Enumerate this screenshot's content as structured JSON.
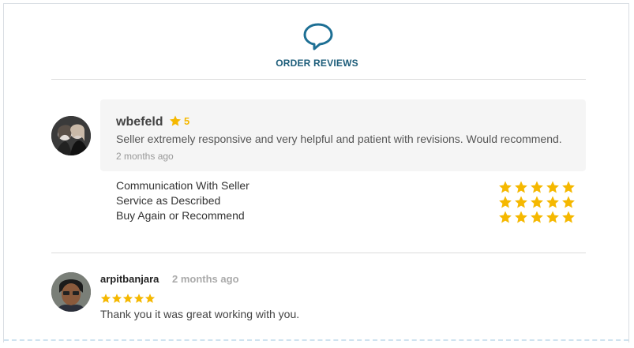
{
  "header": {
    "icon": "speech-bubble-icon",
    "title": "ORDER REVIEWS",
    "accent": "#1d6f94"
  },
  "review1": {
    "name": "wbefeld",
    "rating": "5",
    "text": "Seller extremely responsive and very helpful and patient with revisions. Would recommend.",
    "time": "2 months ago",
    "criteria": [
      {
        "label": "Communication With Seller",
        "stars": 5
      },
      {
        "label": "Service as Described",
        "stars": 5
      },
      {
        "label": "Buy Again or Recommend",
        "stars": 5
      }
    ]
  },
  "review2": {
    "name": "arpitbanjara",
    "time": "2 months ago",
    "stars": 5,
    "text": "Thank you it was great working with you."
  },
  "colors": {
    "star": "#f5b800",
    "divider": "#dcdcdc"
  }
}
